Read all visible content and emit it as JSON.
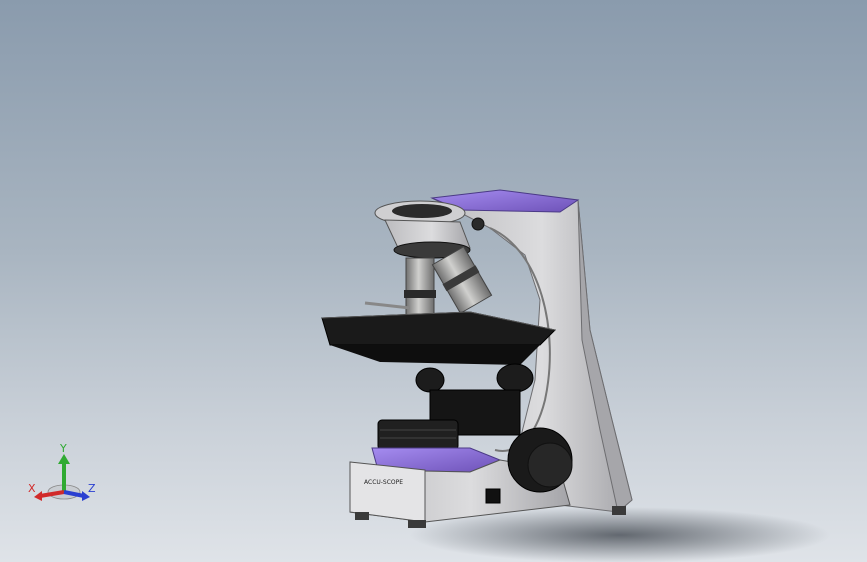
{
  "viewport": {
    "background_top": "#8a9bad",
    "background_bottom": "#dfe3e8"
  },
  "model": {
    "base_label": "ACCU-SCOPE",
    "colors": {
      "body": "#d4d4d6",
      "body_shade": "#9c9ca0",
      "accent": "#8e72d8",
      "dark": "#141414",
      "metal": "#a8a8a6"
    }
  },
  "triad": {
    "x_label": "X",
    "y_label": "Y",
    "z_label": "Z",
    "x_color": "#d12a2a",
    "y_color": "#2faa32",
    "z_color": "#2a3fd1"
  }
}
